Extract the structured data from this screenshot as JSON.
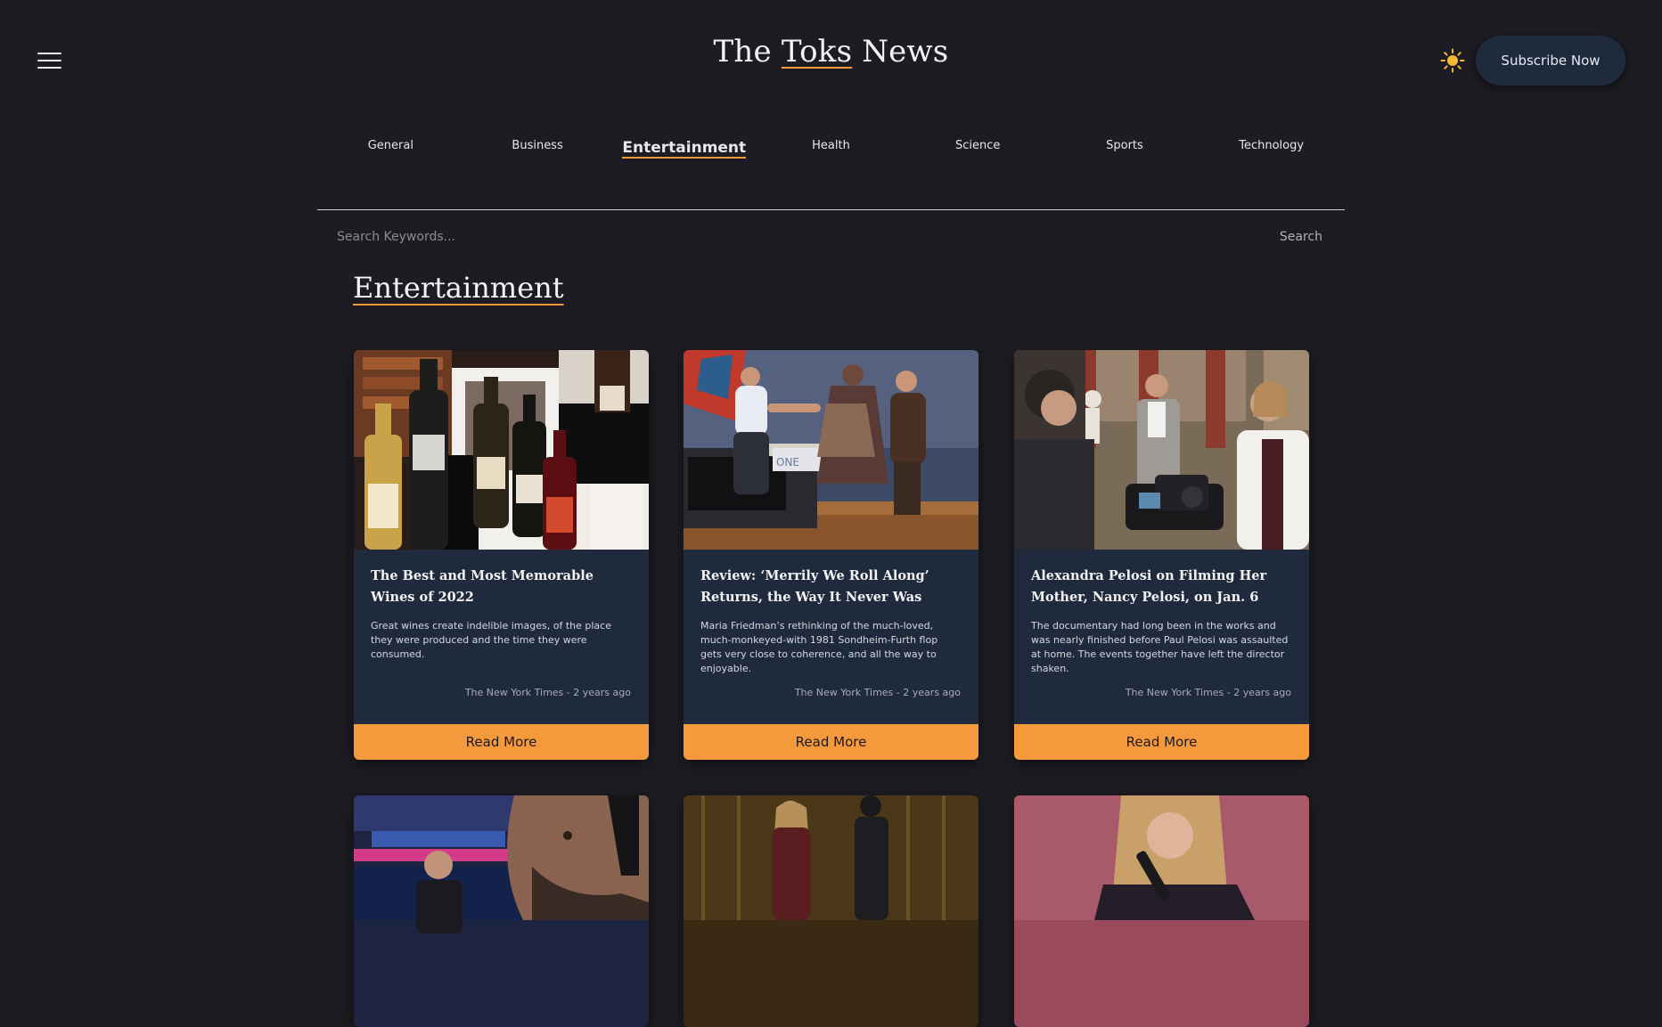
{
  "header": {
    "brand_prefix": "The ",
    "brand_accent": "Toks",
    "brand_suffix": " News",
    "subscribe_label": "Subscribe Now",
    "menu_icon": "hamburger-menu-icon",
    "theme_icon": "sun-icon"
  },
  "categories": [
    {
      "label": "General",
      "active": false
    },
    {
      "label": "Business",
      "active": false
    },
    {
      "label": "Entertainment",
      "active": true
    },
    {
      "label": "Health",
      "active": false
    },
    {
      "label": "Science",
      "active": false
    },
    {
      "label": "Sports",
      "active": false
    },
    {
      "label": "Technology",
      "active": false
    }
  ],
  "search": {
    "placeholder": "Search Keywords...",
    "value": "",
    "button_label": "Search"
  },
  "section": {
    "title": "Entertainment"
  },
  "articles": [
    {
      "title": "The Best and Most Memorable Wines of 2022",
      "description": "Great wines create indelible images, of the place they were produced and the time they were consumed.",
      "source": "The New York Times",
      "separator": "-",
      "time": "2 years ago",
      "read_more": "Read More"
    },
    {
      "title": "Review: ‘Merrily We Roll Along’ Returns, the Way It Never Was",
      "description": "Maria Friedman’s rethinking of the much-loved, much-monkeyed-with 1981 Sondheim-Furth flop gets very close to coherence, and all the way to enjoyable.",
      "source": "The New York Times",
      "separator": "-",
      "time": "2 years ago",
      "read_more": "Read More"
    },
    {
      "title": "Alexandra Pelosi on Filming Her Mother, Nancy Pelosi, on Jan. 6",
      "description": "The documentary had long been in the works and was nearly finished before Paul Pelosi was assaulted at home. The events together have left the director shaken.",
      "source": "The New York Times",
      "separator": "-",
      "time": "2 years ago",
      "read_more": "Read More"
    }
  ],
  "colors": {
    "background": "#1c1c22",
    "card": "#1f2a3d",
    "accent": "#f59a3c",
    "sun": "#f5b82e"
  }
}
